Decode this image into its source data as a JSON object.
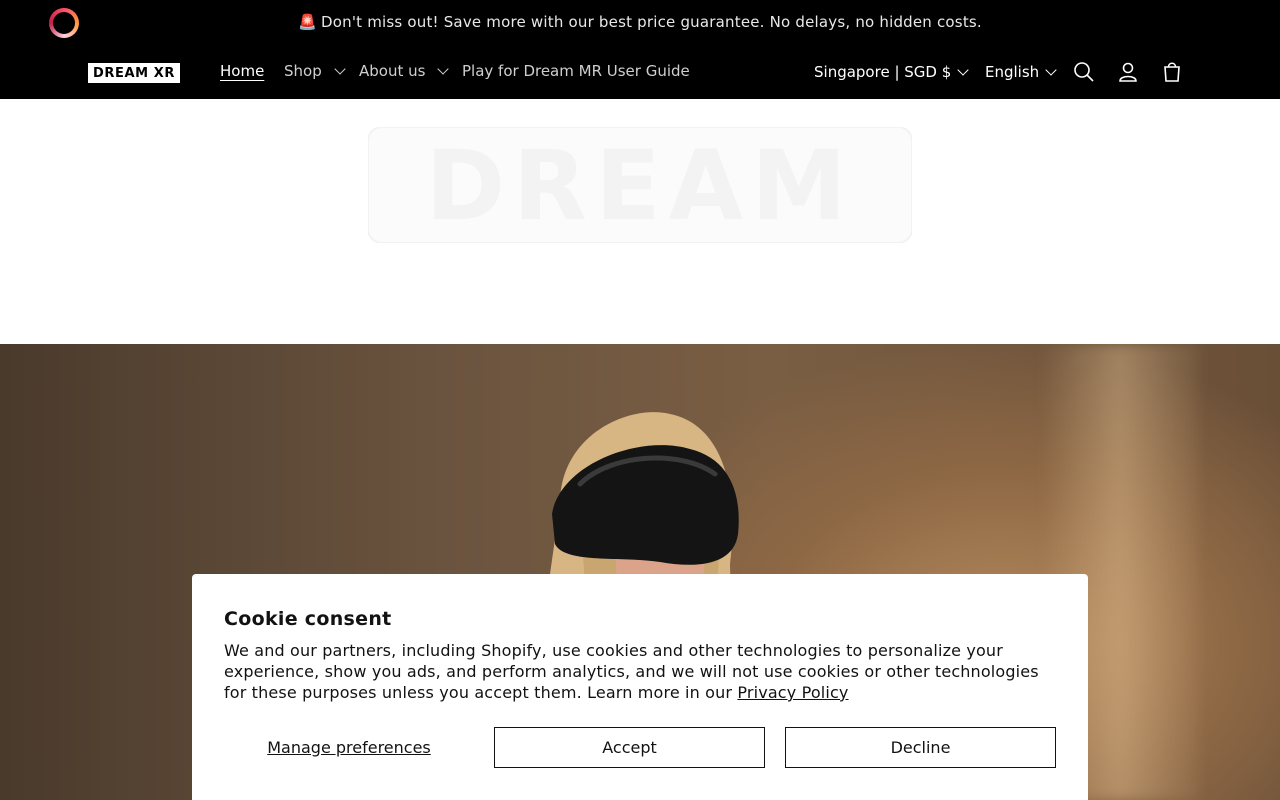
{
  "announcement": {
    "emoji": "🚨",
    "text": "Don't miss out! Save more with our best price guarantee. No delays, no hidden costs."
  },
  "header": {
    "logo_text": "DREAM XR",
    "nav": [
      {
        "label": "Home",
        "active": true
      },
      {
        "label": "Shop",
        "dropdown": true
      },
      {
        "label": "About us",
        "dropdown": true
      },
      {
        "label": "Play for Dream MR User Guide"
      }
    ],
    "country": "Singapore | SGD $",
    "language": "English",
    "icons": [
      "search-icon",
      "account-icon",
      "cart-icon"
    ]
  },
  "banner": {
    "logo_text": "DREAM"
  },
  "cookie": {
    "title": "Cookie consent",
    "body": "We and our partners, including Shopify, use cookies and other technologies to personalize your experience, show you ads, and perform analytics, and we will not use cookies or other technologies for these purposes unless you accept them. Learn more in our",
    "privacy_link": "Privacy Policy",
    "manage_label": "Manage preferences",
    "accept_label": "Accept",
    "decline_label": "Decline"
  }
}
